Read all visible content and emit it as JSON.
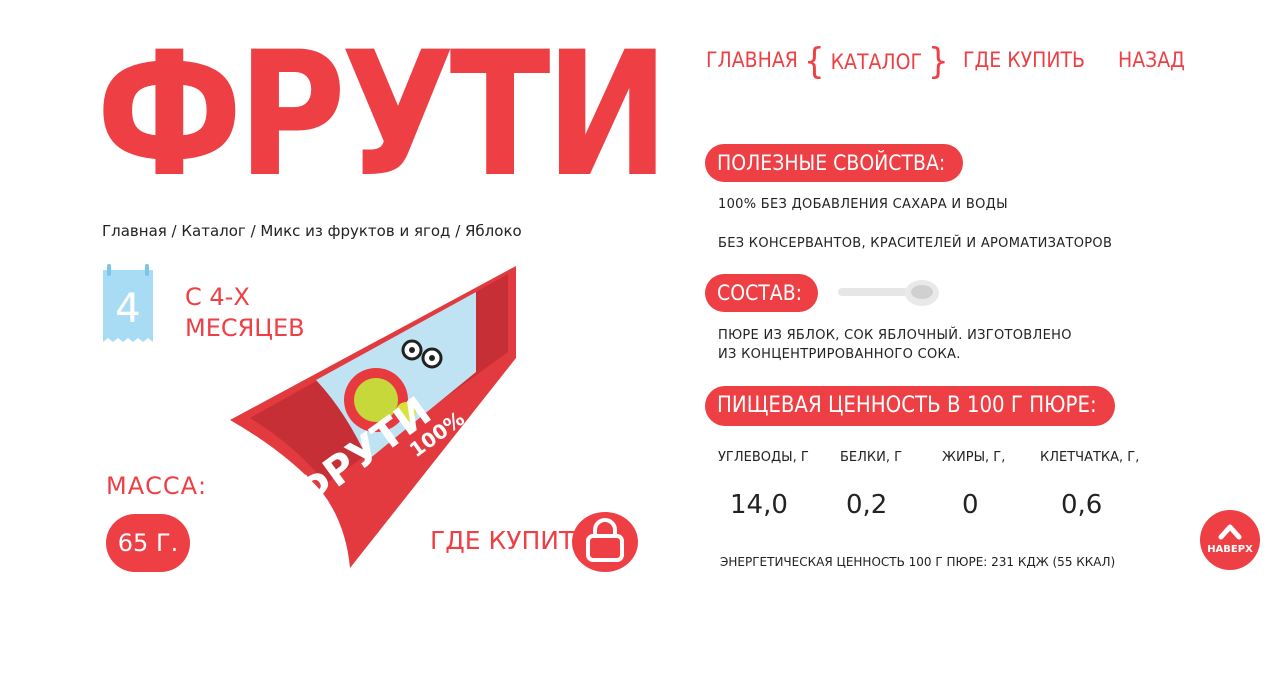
{
  "brand": {
    "logo": "ФРУТИ"
  },
  "nav": {
    "main": "ГЛАВНАЯ",
    "catalog": "КАТАЛОГ",
    "where_to_buy": "ГДЕ КУПИТЬ",
    "back": "НАЗАД",
    "catalog_bracket_left": "{",
    "catalog_bracket_right": "}"
  },
  "breadcrumb": "Главная / Каталог / Микс из фруктов и ягод / Яблоко",
  "age": {
    "number": "4",
    "line1": "С 4-Х",
    "line2": "МЕСЯЦЕВ"
  },
  "product": {
    "pack_brand": "ФРУТИ",
    "pack_percent": "100%"
  },
  "mass": {
    "label": "МАССА:",
    "value": "65 Г."
  },
  "buy": {
    "label": "ГДЕ КУПИТЬ"
  },
  "properties": {
    "title": "ПОЛЕЗНЫЕ СВОЙСТВА:",
    "items": [
      "100% БЕЗ ДОБАВЛЕНИЯ САХАРА И ВОДЫ",
      "БЕЗ КОНСЕРВАНТОВ, КРАСИТЕЛЕЙ И АРОМАТИЗАТОРОВ"
    ]
  },
  "composition": {
    "title": "СОСТАВ:",
    "text": "ПЮРЕ ИЗ ЯБЛОК, СОК ЯБЛОЧНЫЙ. ИЗГОТОВЛЕНО ИЗ КОНЦЕНТРИРОВАННОГО СОКА."
  },
  "nutrition": {
    "title": "ПИЩЕВАЯ ЦЕННОСТЬ В 100 Г ПЮРЕ:",
    "headers": [
      "УГЛЕВОДЫ, Г",
      "БЕЛКИ, Г",
      "ЖИРЫ, Г,",
      "КЛЕТЧАТКА, Г,"
    ],
    "values": [
      "14,0",
      "0,2",
      "0",
      "0,6"
    ],
    "energy": "ЭНЕРГЕТИЧЕСКАЯ ЦЕННОСТЬ 100 Г ПЮРЕ: 231 КДЖ (55 ККАЛ)"
  },
  "to_top": {
    "label": "НАВЕРХ"
  },
  "colors": {
    "accent": "#ee3f45",
    "calendar": "#a8dcf5",
    "text": "#222222"
  }
}
